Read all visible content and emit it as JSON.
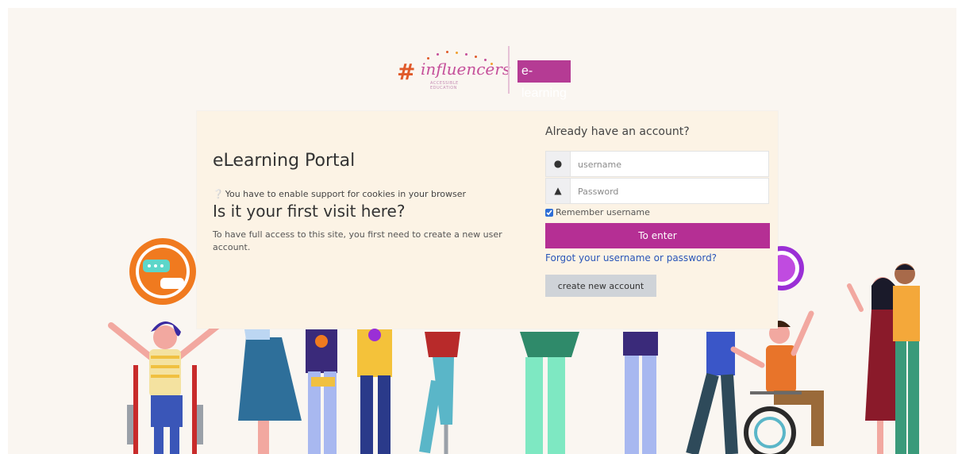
{
  "brand": {
    "logo_hash": "#",
    "logo_word": "influencers",
    "logo_tagline": "ACCESSIBLE EDUCATION",
    "badge": "e-learning",
    "colors": {
      "brand_pink": "#b53b94",
      "button": "#b52f94",
      "link": "#2a56b8"
    }
  },
  "portal": {
    "title": "eLearning Portal",
    "cookie_icon": "help-circle-icon",
    "cookie_notice": "You have to enable support for cookies in your browser",
    "first_visit_heading": "Is it your first visit here?",
    "first_visit_text": "To have full access to this site, you first need to create a new user account."
  },
  "login": {
    "heading": "Already have an account?",
    "username_placeholder": "username",
    "username_icon": "user-icon",
    "password_placeholder": "Password",
    "password_icon": "lock-icon",
    "remember_label": "Remember username",
    "remember_checked": true,
    "enter_label": "To enter",
    "forgot_label": "Forgot your username or password?",
    "create_label": "create new account"
  }
}
